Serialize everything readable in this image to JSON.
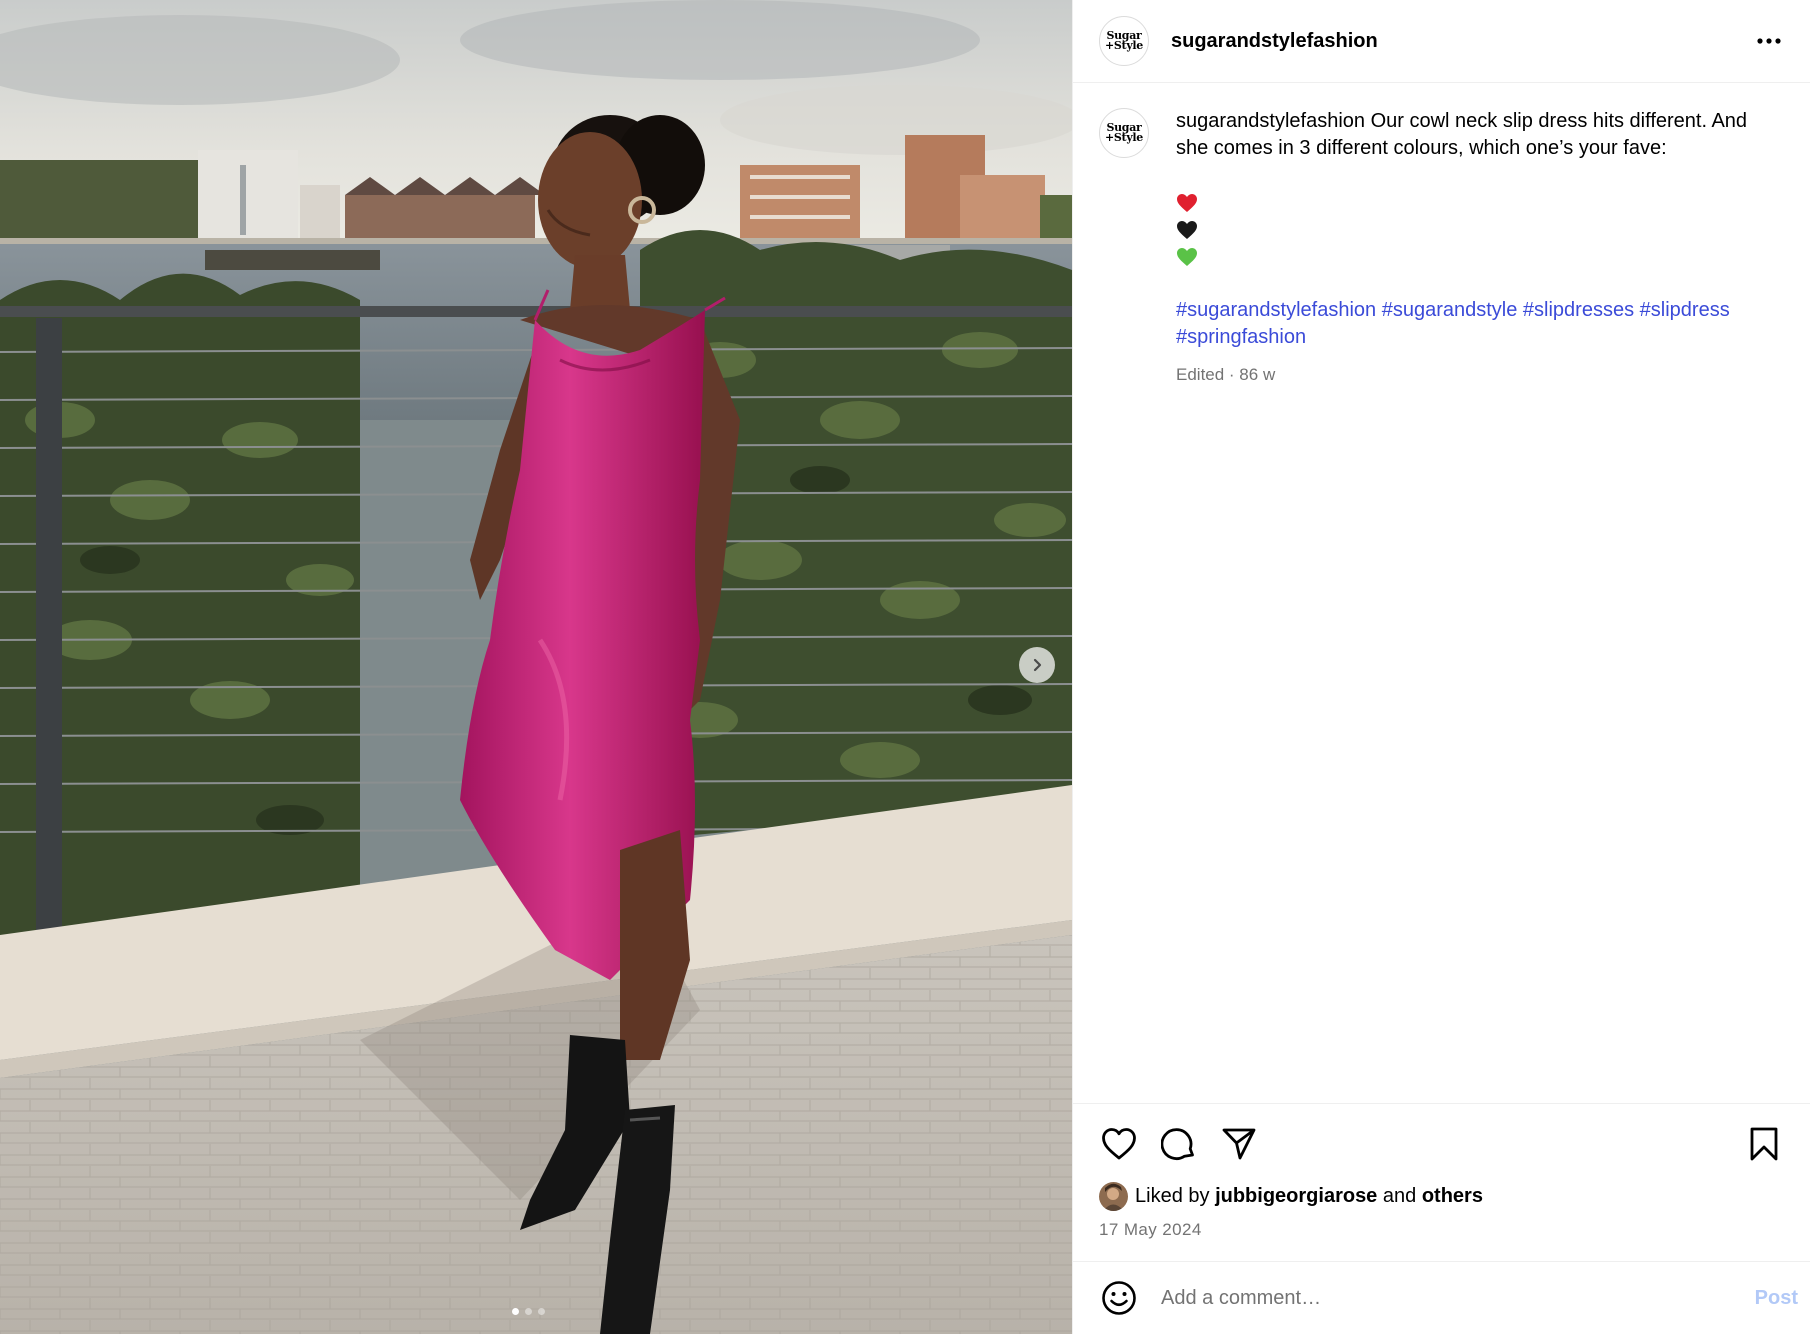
{
  "header": {
    "avatar_text_line1": "Sugar",
    "avatar_text_line2": "+Style",
    "username": "sugarandstylefashion",
    "more_icon": "more-horizontal-icon"
  },
  "media": {
    "description_icon": "photo-carousel",
    "next_icon": "chevron-right-icon",
    "slide_count": 3,
    "active_slide": 1
  },
  "caption": {
    "username": "sugarandstylefashion",
    "text": "Our cowl neck slip dress hits different. And she comes in 3 different colours, which one’s your fave:",
    "emojis": [
      "❤️",
      "🖤",
      "💚"
    ],
    "hashtags": [
      "#sugarandstylefashion",
      "#sugarandstyle",
      "#slipdresses",
      "#slipdress",
      "#springfashion"
    ],
    "meta": "Edited · 86 w"
  },
  "actions": {
    "like_icon": "heart-icon",
    "comment_icon": "comment-icon",
    "share_icon": "share-icon",
    "save_icon": "bookmark-icon"
  },
  "likes": {
    "prefix": "Liked by",
    "user": "jubbigeorgiarose",
    "joiner": "and",
    "others": "others"
  },
  "date": "17 May 2024",
  "comment": {
    "emoji_icon": "emoji-icon",
    "placeholder": "Add a comment…",
    "post_label": "Post"
  },
  "colors": {
    "hashtag": "#3b4bd8",
    "secondary_text": "#737373",
    "post_button_disabled": "#b2c9f7",
    "divider": "#efefef"
  }
}
